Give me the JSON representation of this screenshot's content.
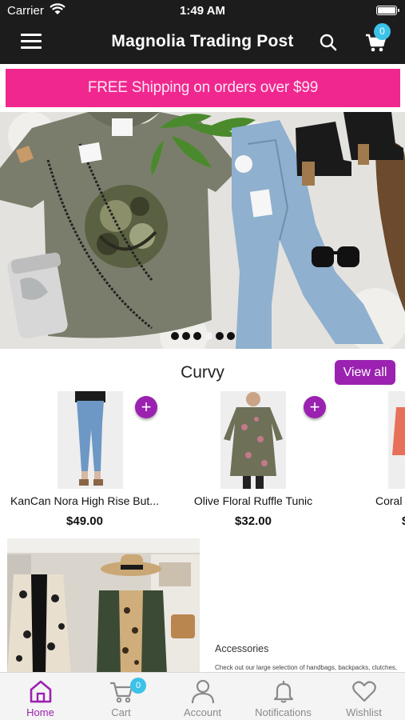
{
  "status": {
    "carrier": "Carrier",
    "time": "1:49 AM"
  },
  "header": {
    "title": "Magnolia Trading Post",
    "cart_count": "0"
  },
  "promo": {
    "text": "FREE Shipping on orders over $99"
  },
  "hero": {
    "slide_count": 6,
    "active_slide": 4
  },
  "section": {
    "title": "Curvy",
    "view_all_label": "View all",
    "products": [
      {
        "name": "KanCan Nora High Rise But...",
        "price": "$49.00"
      },
      {
        "name": "Olive Floral Ruffle Tunic",
        "price": "$32.00"
      },
      {
        "name": "Coral",
        "price": "$"
      }
    ]
  },
  "accessories": {
    "title": "Accessories",
    "description": "Check out our large selection of handbags, backpacks, clutches,"
  },
  "tabbar": {
    "tabs": [
      {
        "label": "Home",
        "icon": "home-icon"
      },
      {
        "label": "Cart",
        "icon": "cart-icon",
        "badge": "0"
      },
      {
        "label": "Account",
        "icon": "account-icon"
      },
      {
        "label": "Notifications",
        "icon": "bell-icon"
      },
      {
        "label": "Wishlist",
        "icon": "heart-icon"
      }
    ]
  },
  "colors": {
    "accent": "#9b22b0",
    "promo": "#f0278f",
    "badge": "#3bc2e8",
    "header": "#1c1c1c"
  }
}
